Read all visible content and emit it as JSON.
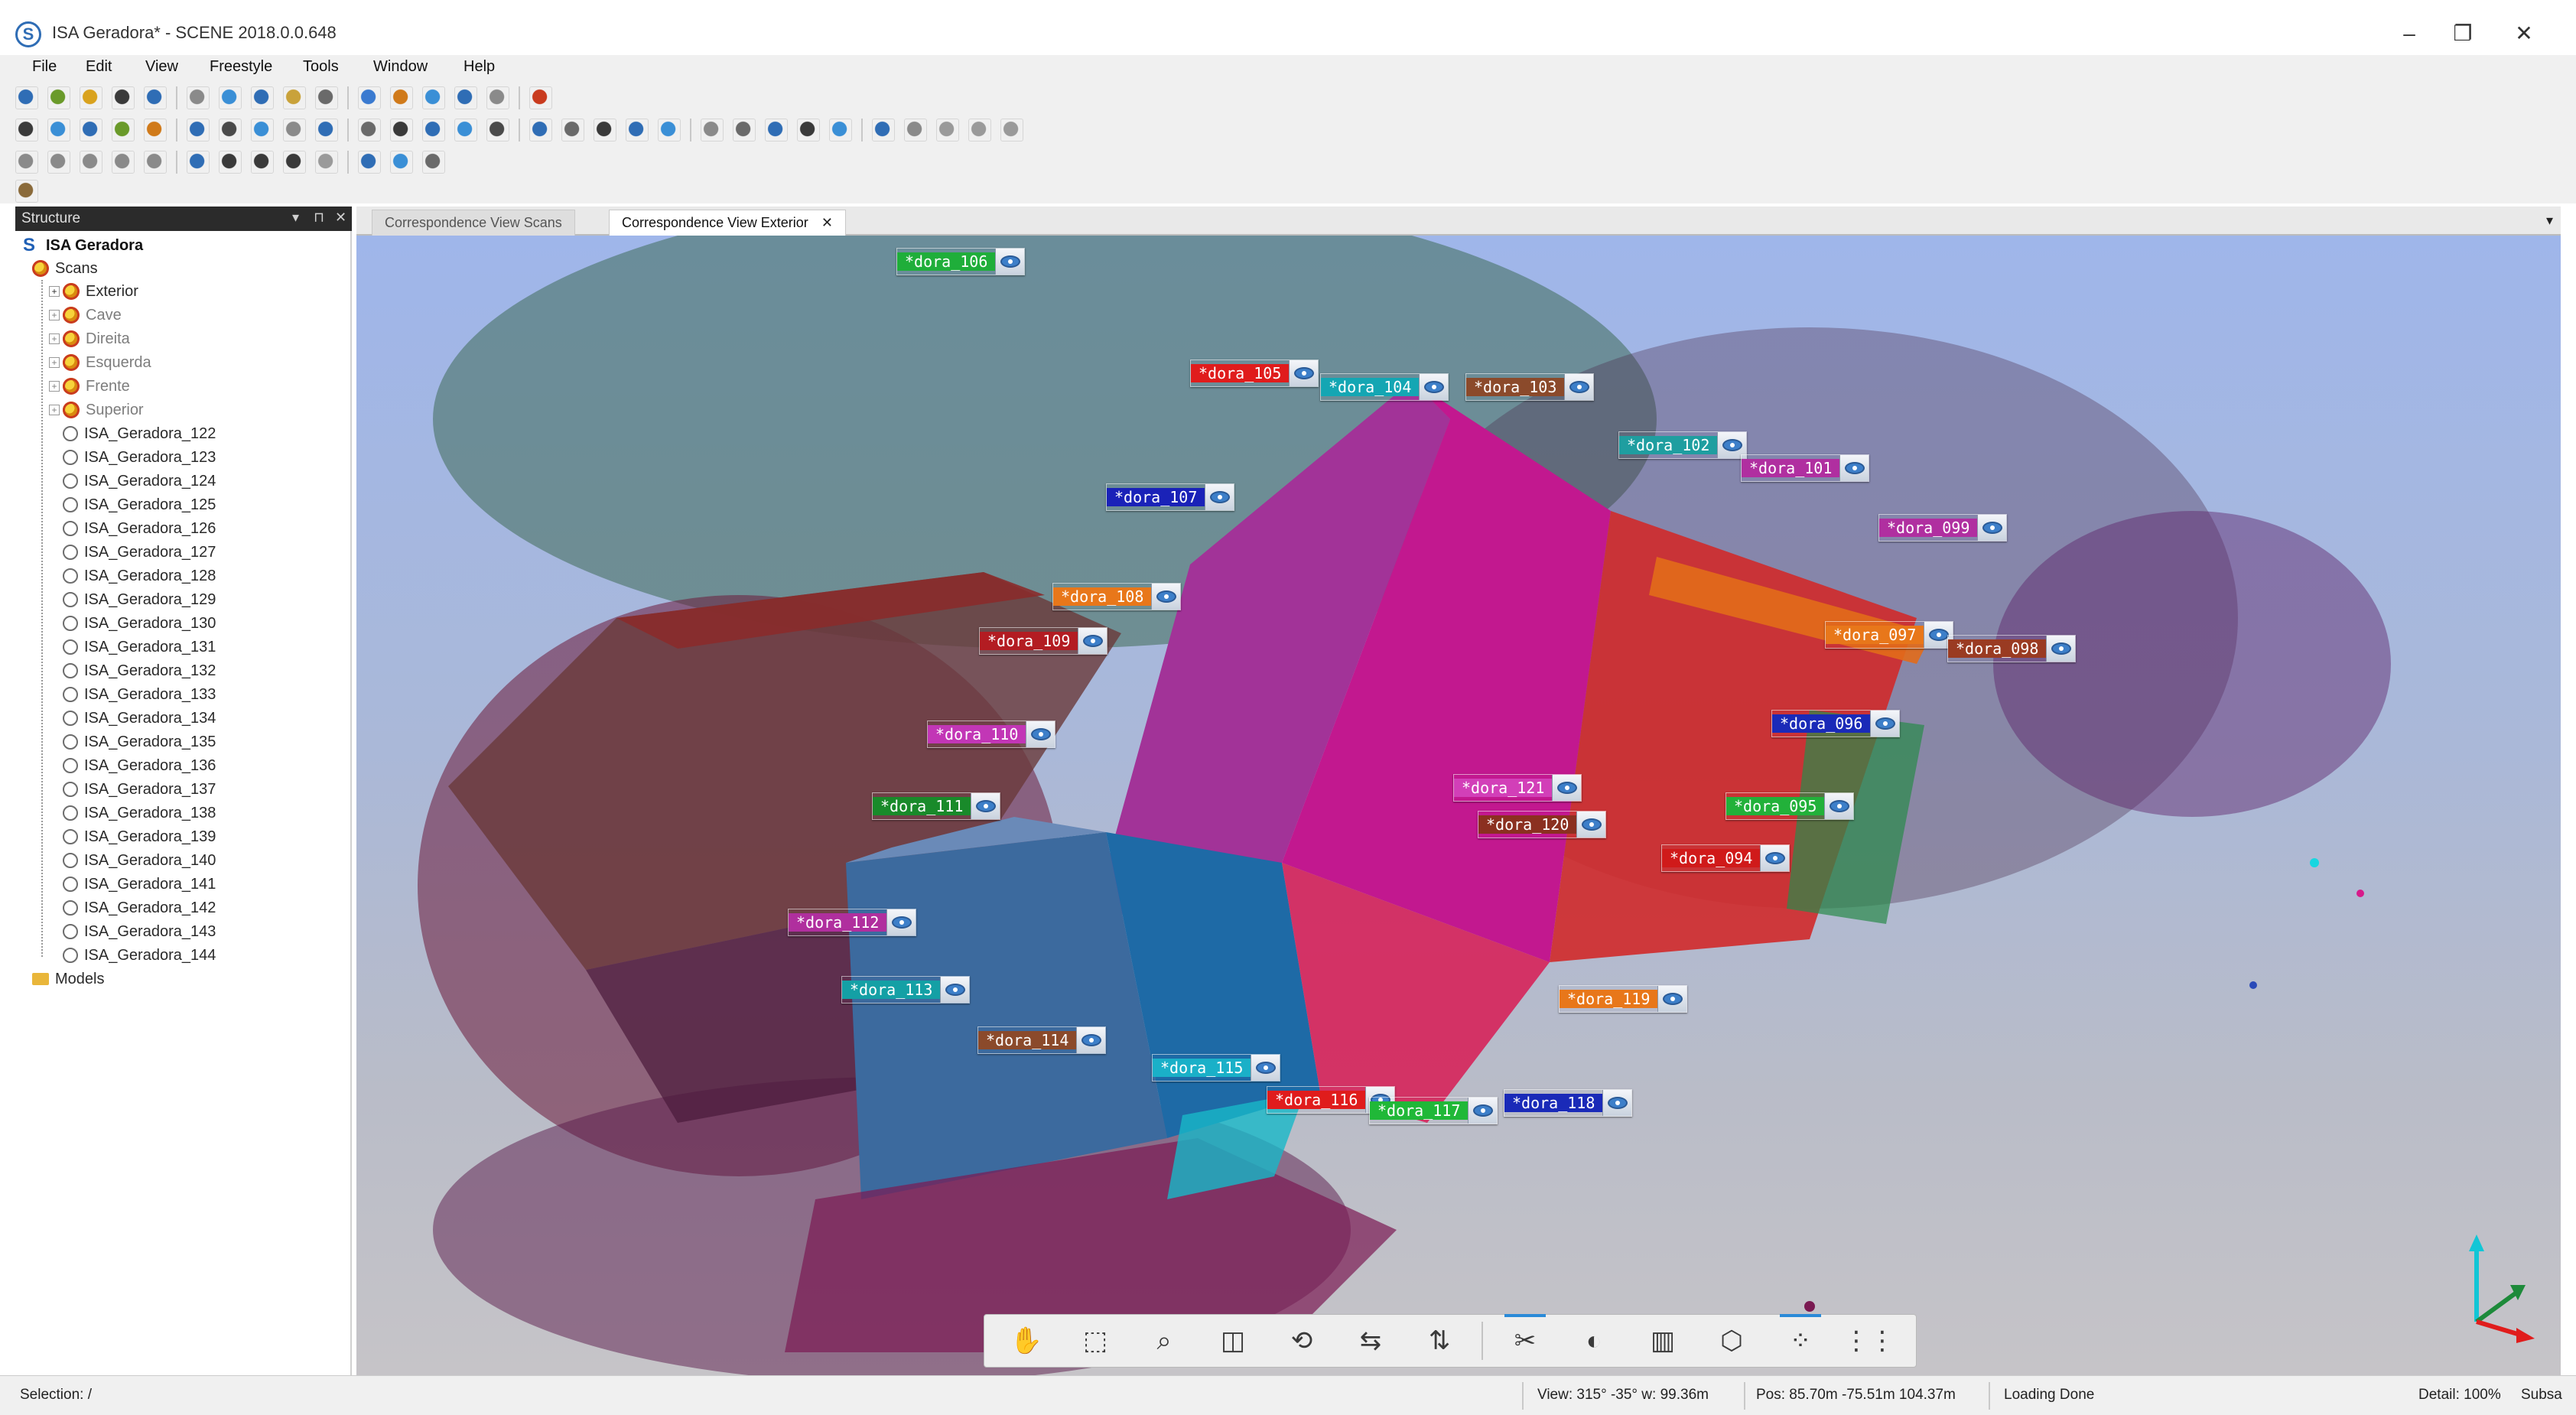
{
  "window": {
    "title": "ISA Geradora* - SCENE 2018.0.0.648",
    "logo_glyph": "S",
    "minimize_glyph": "–",
    "restore_glyph": "❐",
    "close_glyph": "✕"
  },
  "menu": [
    "File",
    "Edit",
    "View",
    "Freestyle",
    "Tools",
    "Window",
    "Help"
  ],
  "structure_panel": {
    "title": "Structure",
    "controls": [
      "▾",
      "⊓",
      "✕"
    ],
    "root": "ISA Geradora",
    "scans_label": "Scans",
    "clusters": [
      {
        "label": "Exterior",
        "dim": false
      },
      {
        "label": "Cave",
        "dim": true
      },
      {
        "label": "Direita",
        "dim": true
      },
      {
        "label": "Esquerda",
        "dim": true
      },
      {
        "label": "Frente",
        "dim": true
      },
      {
        "label": "Superior",
        "dim": true
      }
    ],
    "scans": [
      "ISA_Geradora_122",
      "ISA_Geradora_123",
      "ISA_Geradora_124",
      "ISA_Geradora_125",
      "ISA_Geradora_126",
      "ISA_Geradora_127",
      "ISA_Geradora_128",
      "ISA_Geradora_129",
      "ISA_Geradora_130",
      "ISA_Geradora_131",
      "ISA_Geradora_132",
      "ISA_Geradora_133",
      "ISA_Geradora_134",
      "ISA_Geradora_135",
      "ISA_Geradora_136",
      "ISA_Geradora_137",
      "ISA_Geradora_138",
      "ISA_Geradora_139",
      "ISA_Geradora_140",
      "ISA_Geradora_141",
      "ISA_Geradora_142",
      "ISA_Geradora_143",
      "ISA_Geradora_144"
    ],
    "models_label": "Models"
  },
  "tabs": {
    "items": [
      {
        "label": "Correspondence View Scans",
        "active": false
      },
      {
        "label": "Correspondence View Exterior",
        "active": true
      }
    ],
    "close_glyph": "✕",
    "dropdown_glyph": "▾"
  },
  "scan_tags": [
    {
      "label": "*dora_106",
      "color": "#1fae3a"
    },
    {
      "label": "*dora_105",
      "color": "#e01c1c"
    },
    {
      "label": "*dora_104",
      "color": "#14a6b3"
    },
    {
      "label": "*dora_103",
      "color": "#8b4a2b"
    },
    {
      "label": "*dora_102",
      "color": "#1f9ea0"
    },
    {
      "label": "*dora_101",
      "color": "#b02fa0"
    },
    {
      "label": "*dora_099",
      "color": "#b02fa0"
    },
    {
      "label": "*dora_107",
      "color": "#1a22b8"
    },
    {
      "label": "*dora_108",
      "color": "#e8771a"
    },
    {
      "label": "*dora_109",
      "color": "#b31c22"
    },
    {
      "label": "*dora_097",
      "color": "#e8771a"
    },
    {
      "label": "*dora_098",
      "color": "#9a3b22"
    },
    {
      "label": "*dora_096",
      "color": "#1a2ab8"
    },
    {
      "label": "*dora_110",
      "color": "#c236b6"
    },
    {
      "label": "*dora_121",
      "color": "#d23fb8"
    },
    {
      "label": "*dora_120",
      "color": "#8b3020"
    },
    {
      "label": "*dora_095",
      "color": "#22b13a"
    },
    {
      "label": "*dora_111",
      "color": "#198a2a"
    },
    {
      "label": "*dora_094",
      "color": "#d01a1a"
    },
    {
      "label": "*dora_112",
      "color": "#b02f9e"
    },
    {
      "label": "*dora_113",
      "color": "#14a0a5"
    },
    {
      "label": "*dora_119",
      "color": "#e8771a"
    },
    {
      "label": "*dora_114",
      "color": "#8b4a2b"
    },
    {
      "label": "*dora_115",
      "color": "#1ab0c8"
    },
    {
      "label": "*dora_116",
      "color": "#e01c1c"
    },
    {
      "label": "*dora_117",
      "color": "#20b838"
    },
    {
      "label": "*dora_118",
      "color": "#1a2ab8"
    }
  ],
  "nav_bar": {
    "buttons": [
      {
        "name": "hand-navigation",
        "glyph": "✋"
      },
      {
        "name": "walk-mode",
        "glyph": "⬚"
      },
      {
        "name": "zoom",
        "glyph": "⌕"
      },
      {
        "name": "view-cube",
        "glyph": "◫"
      },
      {
        "name": "rotate",
        "glyph": "⟲"
      },
      {
        "name": "flip-view",
        "glyph": "⇆"
      },
      {
        "name": "align-view",
        "glyph": "⇅"
      },
      {
        "name": "clipping-box",
        "glyph": "✂"
      },
      {
        "name": "slice",
        "glyph": "◐"
      },
      {
        "name": "section",
        "glyph": "▥"
      },
      {
        "name": "box-view",
        "glyph": "⬡"
      },
      {
        "name": "scan-points",
        "glyph": "⁘"
      },
      {
        "name": "more-options",
        "glyph": "⋮⋮"
      }
    ]
  },
  "status_bar": {
    "selection": "Selection: /",
    "view": "View: 315° -35° w: 99.36m",
    "position": "Pos: 85.70m -75.51m 104.37m",
    "loading": "Loading Done",
    "detail": "Detail: 100%",
    "subsample": "Subsa"
  },
  "colors": {
    "accent": "#2a8ad8",
    "panel_header": "#2b2b2b",
    "sky": "#9fb6ea"
  }
}
